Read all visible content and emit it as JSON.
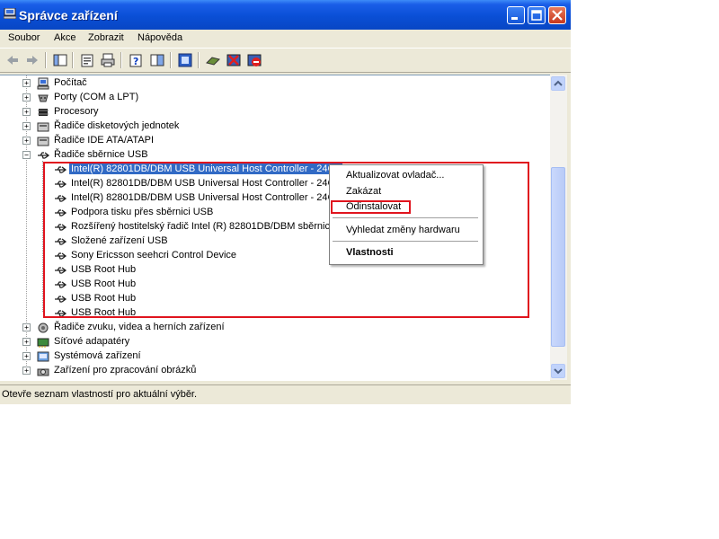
{
  "window": {
    "title": "Správce zařízení",
    "titlebar_color": "#0a4fd6",
    "buttons": [
      "minimize-icon",
      "maximize-icon",
      "close-icon"
    ]
  },
  "menubar": {
    "items": [
      "Soubor",
      "Akce",
      "Zobrazit",
      "Nápověda"
    ]
  },
  "toolbar": {
    "icons": [
      "back-arrow-icon",
      "forward-arrow-icon",
      "show-hide-console-tree-icon",
      "properties-icon",
      "print-icon",
      "help-icon",
      "export-list-icon",
      "refresh-icon",
      "scan-hardware-icon",
      "uninstall-icon",
      "disable-icon"
    ]
  },
  "tree": {
    "items": [
      {
        "label": "Počítač",
        "icon": "computer-icon",
        "expander": "+"
      },
      {
        "label": "Porty (COM a LPT)",
        "icon": "port-icon",
        "expander": "+"
      },
      {
        "label": "Procesory",
        "icon": "processor-icon",
        "expander": "+"
      },
      {
        "label": "Řadiče disketových jednotek",
        "icon": "floppy-controller-icon",
        "expander": "+"
      },
      {
        "label": "Řadiče IDE ATA/ATAPI",
        "icon": "ide-controller-icon",
        "expander": "+"
      },
      {
        "label": "Řadiče sběrnice USB",
        "icon": "usb-icon",
        "expander": "−"
      }
    ],
    "usb_children": [
      {
        "label": "Intel(R) 82801DB/DBM USB Universal Host Controller - 24C2",
        "selected": true
      },
      {
        "label": "Intel(R) 82801DB/DBM USB Universal Host Controller - 24C4"
      },
      {
        "label": "Intel(R) 82801DB/DBM USB Universal Host Controller - 24C7"
      },
      {
        "label": "Podpora tisku přes sběrnici USB"
      },
      {
        "label": "Rozšířený hostitelský řadič Intel (R) 82801DB/DBM sběrnice"
      },
      {
        "label": "Složené zařízení USB"
      },
      {
        "label": "Sony Ericsson seehcri Control Device"
      },
      {
        "label": "USB Root Hub"
      },
      {
        "label": "USB Root Hub"
      },
      {
        "label": "USB Root Hub"
      },
      {
        "label": "USB Root Hub"
      }
    ],
    "after_items": [
      {
        "label": "Řadiče zvuku, videa a herních zařízení",
        "icon": "sound-icon",
        "expander": "+"
      },
      {
        "label": "Síťové adapatéry",
        "icon": "network-adapter-icon",
        "expander": "+"
      },
      {
        "label": "Systémová zařízení",
        "icon": "system-device-icon",
        "expander": "+"
      },
      {
        "label": "Zařízení pro zpracování obrázků",
        "icon": "imaging-device-icon",
        "expander": "+"
      }
    ]
  },
  "context_menu": {
    "items": [
      {
        "label": "Aktualizovat ovladač..."
      },
      {
        "label": "Zakázat"
      },
      {
        "label": "Odinstalovat",
        "highlighted": true
      },
      {
        "label": "Vyhledat změny hardwaru"
      },
      {
        "label": "Vlastnosti",
        "bold": true
      }
    ]
  },
  "statusbar": {
    "text": "Otevře seznam vlastností pro aktuální výběr."
  },
  "colors": {
    "selection": "#316ac5",
    "highlight_box": "#e0141e",
    "window_bg": "#ece9d8"
  }
}
